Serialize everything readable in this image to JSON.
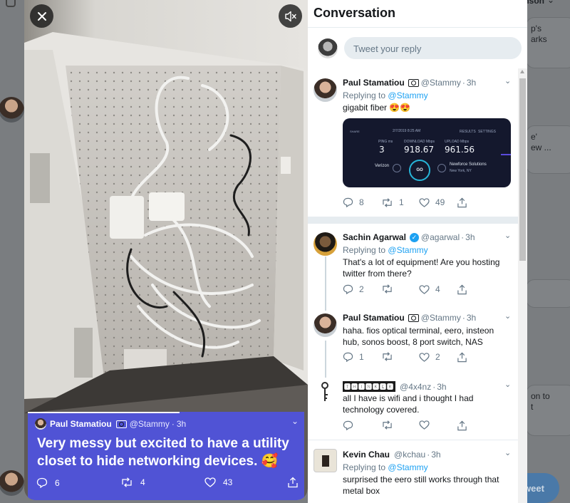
{
  "background": {
    "username_fragment": "...inson",
    "card1_text": "p's\narks",
    "card2_text": "e'\new ...",
    "card3_text": "on to\nt",
    "tweet_button": "weet"
  },
  "media": {
    "close_icon": "close-icon",
    "mute_icon": "speaker-muted-icon",
    "overlay": {
      "name": "Paul Stamatiou",
      "handle": "@Stammy",
      "time": "3h",
      "text": "Very messy but excited to have a utility closet to hide networking  devices. 🥰",
      "replies": "6",
      "retweets": "4",
      "likes": "43",
      "progress_fraction": 0.55
    }
  },
  "conversation": {
    "title": "Conversation",
    "reply_placeholder": "Tweet your reply",
    "tweets": [
      {
        "name": "Paul Stamatiou",
        "handle": "@Stammy",
        "time": "3h",
        "replying_label": "Replying to",
        "replying_to": "@Stammy",
        "text": "gigabit fiber 😍😍",
        "replies": "8",
        "retweets": "1",
        "likes": "49",
        "speedtest": {
          "share": "SHARE",
          "date": "2/7/2019 8:25 AM",
          "results": "RESULTS",
          "settings": "SETTINGS",
          "ping_label": "PING ms",
          "ping": "3",
          "download_label": "DOWNLOAD Mbps",
          "download": "918.67",
          "upload_label": "UPLOAD Mbps",
          "upload": "961.56",
          "go": "GO",
          "isp": "Verizon",
          "server": "Newforce Solutions",
          "server_loc": "New York, NY"
        }
      },
      {
        "name": "Sachin Agarwal",
        "handle": "@agarwal",
        "time": "3h",
        "replying_label": "Replying to",
        "replying_to": "@Stammy",
        "text": "That's a lot of equipment! Are you hosting twitter from there?",
        "replies": "2",
        "retweets": "",
        "likes": "4"
      },
      {
        "name": "Paul Stamatiou",
        "handle": "@Stammy",
        "time": "3h",
        "text": "haha. fios optical terminal, eero, insteon hub, sonos boost, 8 port switch, NAS",
        "replies": "1",
        "retweets": "",
        "likes": "2"
      },
      {
        "name": "🆃🅷🅸🅽🅺🅴🆁",
        "handle": "@4x4nz",
        "time": "3h",
        "text": "all I have is wifi and i thought I had technology covered.",
        "replies": "",
        "retweets": "",
        "likes": ""
      },
      {
        "name": "Kevin Chau",
        "handle": "@kchau",
        "time": "3h",
        "replying_label": "Replying to",
        "replying_to": "@Stammy",
        "text": "surprised the eero still works through that metal box"
      }
    ]
  }
}
